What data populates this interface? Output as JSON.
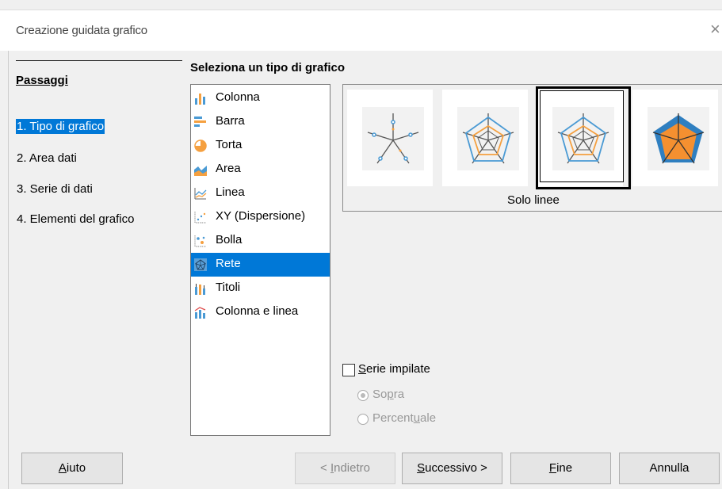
{
  "window": {
    "title": "Creazione guidata grafico",
    "close_glyph": "×"
  },
  "steps": {
    "heading": "Passaggi",
    "items": [
      {
        "label": "1. Tipo di grafico",
        "active": true
      },
      {
        "label": "2. Area dati",
        "active": false
      },
      {
        "label": "3. Serie di dati",
        "active": false
      },
      {
        "label": "4. Elementi del grafico",
        "active": false
      }
    ]
  },
  "chart_types": {
    "heading": "Seleziona un tipo di grafico",
    "selected": "Rete",
    "items": [
      {
        "label": "Colonna",
        "icon": "column-chart-icon"
      },
      {
        "label": "Barra",
        "icon": "bar-chart-icon"
      },
      {
        "label": "Torta",
        "icon": "pie-chart-icon"
      },
      {
        "label": "Area",
        "icon": "area-chart-icon"
      },
      {
        "label": "Linea",
        "icon": "line-chart-icon"
      },
      {
        "label": "XY (Dispersione)",
        "icon": "scatter-chart-icon"
      },
      {
        "label": "Bolla",
        "icon": "bubble-chart-icon"
      },
      {
        "label": "Rete",
        "icon": "net-chart-icon"
      },
      {
        "label": "Titoli",
        "icon": "stock-chart-icon"
      },
      {
        "label": "Colonna e linea",
        "icon": "column-line-chart-icon"
      }
    ]
  },
  "variants": {
    "selected_index": 2,
    "selected_label": "Solo linee",
    "items": [
      {
        "icon": "net-points-only-icon"
      },
      {
        "icon": "net-points-lines-icon"
      },
      {
        "icon": "net-lines-only-icon"
      },
      {
        "icon": "net-filled-icon"
      }
    ]
  },
  "options": {
    "stack_series": {
      "pre": "",
      "accel": "S",
      "post": "erie impilate",
      "checked": false
    },
    "on_top": {
      "pre": "So",
      "accel": "p",
      "post": "ra",
      "selected": true,
      "enabled": false
    },
    "percent": {
      "pre": "Percent",
      "accel": "u",
      "post": "ale",
      "selected": false,
      "enabled": false
    }
  },
  "buttons": {
    "help": {
      "pre": "",
      "accel": "A",
      "post": "iuto"
    },
    "back": {
      "pre": "< ",
      "accel": "I",
      "post": "ndietro",
      "enabled": false
    },
    "next": {
      "pre": "",
      "accel": "S",
      "post": "uccessivo >"
    },
    "finish": {
      "pre": "",
      "accel": "F",
      "post": "ine"
    },
    "cancel": {
      "pre": "",
      "accel": "",
      "post": "Annulla"
    }
  },
  "colors": {
    "selection": "#0078d7",
    "series_blue": "#4a9ad4",
    "series_orange": "#f5a040",
    "series_dark": "#444444"
  }
}
